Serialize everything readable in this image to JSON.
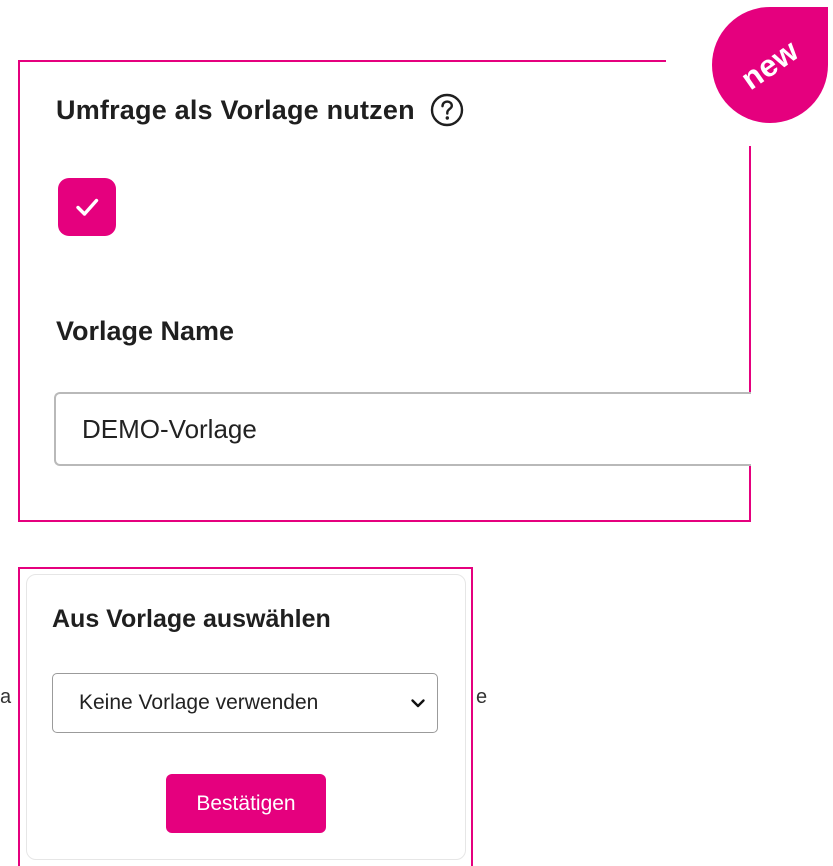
{
  "template_panel": {
    "heading": "Umfrage als Vorlage nutzen",
    "help_icon": "question-circle-icon",
    "use_as_template_checked": true,
    "checkbox_icon": "checkmark-icon",
    "name_label": "Vorlage Name",
    "name_value": "DEMO-Vorlage"
  },
  "badge": {
    "text": "new",
    "color": "#e5007e"
  },
  "choose_panel": {
    "heading": "Aus Vorlage auswählen",
    "select_value": "Keine Vorlage verwenden",
    "select_icon": "chevron-down-icon",
    "confirm_label": "Bestätigen"
  },
  "background": {
    "left_fragment": "a",
    "right_fragment": "e"
  },
  "colors": {
    "accent": "#e5007e",
    "text": "#1f1f1f",
    "input_border": "#b9b9b9"
  }
}
